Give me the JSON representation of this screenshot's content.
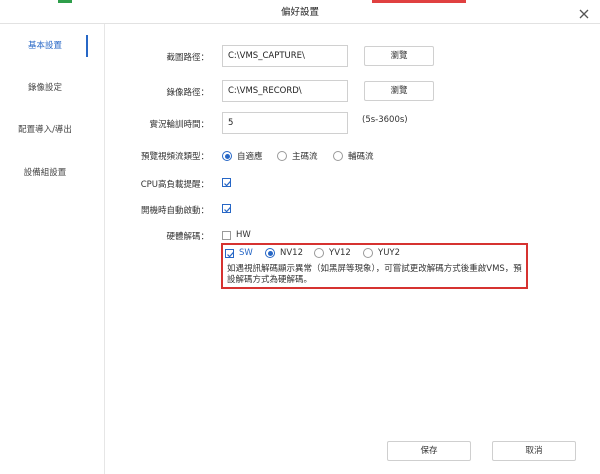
{
  "window": {
    "title": "偏好設置"
  },
  "sidebar": {
    "items": [
      {
        "label": "基本設置",
        "active": true
      },
      {
        "label": "錄像設定",
        "active": false
      },
      {
        "label": "配置導入/導出",
        "active": false
      },
      {
        "label": "設備組設置",
        "active": false
      }
    ]
  },
  "form": {
    "capture_path": {
      "label": "截圖路徑：",
      "value": "C:\\VMS_CAPTURE\\",
      "browse": "瀏覽"
    },
    "record_path": {
      "label": "錄像路徑：",
      "value": "C:\\VMS_RECORD\\",
      "browse": "瀏覽"
    },
    "poll_interval": {
      "label": "實況輪訓時間：",
      "value": "5",
      "hint": "(5s-3600s)"
    },
    "stream_type": {
      "label": "預覽視頻流類型：",
      "options": [
        "自適應",
        "主碼流",
        "輔碼流"
      ],
      "selected": "自適應"
    },
    "cpu_alert": {
      "label": "CPU高負載提醒：",
      "checked": true
    },
    "auto_start": {
      "label": "開機時自動啟動：",
      "checked": true
    },
    "hw_decode": {
      "label": "硬體解碼：",
      "hw": {
        "label": "HW",
        "checked": false
      },
      "sw": {
        "label": "SW",
        "checked": true
      },
      "formats": [
        "NV12",
        "YV12",
        "YUY2"
      ],
      "selected_format": "NV12",
      "note": "如遇視訊解碼顯示異常（如黑屏等現象），可嘗試更改解碼方式後重啟VMS，預設解碼方式為硬解碼。"
    }
  },
  "footer": {
    "save": "保存",
    "cancel": "取消"
  },
  "colors": {
    "accent": "#2767c6",
    "highlight_box": "#d63230"
  }
}
